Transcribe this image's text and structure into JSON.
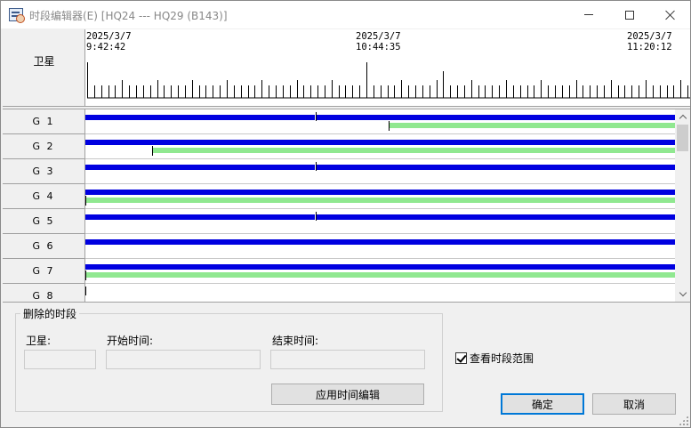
{
  "window": {
    "title": "时段编辑器(E) [HQ24 --- HQ29 (B143)]"
  },
  "timeline": {
    "header_label": "卫星",
    "start": {
      "date": "2025/3/7",
      "time": "9:42:42"
    },
    "middle": {
      "date": "2025/3/7",
      "time": "10:44:35"
    },
    "end": {
      "date": "2025/3/7",
      "time": "11:20:12"
    }
  },
  "rows": [
    {
      "label": "G 1",
      "blue": [
        [
          0,
          0.389
        ],
        [
          0.392,
          1
        ]
      ],
      "green": [
        [
          0.515,
          1
        ]
      ],
      "marks": [
        0.39,
        0.514
      ]
    },
    {
      "label": "G 2",
      "blue": [
        [
          0,
          1
        ]
      ],
      "green": [
        [
          0.114,
          1
        ]
      ],
      "marks": [
        0.113
      ]
    },
    {
      "label": "G 3",
      "blue": [
        [
          0,
          0.389
        ],
        [
          0.392,
          1
        ]
      ],
      "green": [],
      "marks": [
        0.39
      ]
    },
    {
      "label": "G 4",
      "blue": [
        [
          0,
          1
        ]
      ],
      "green": [
        [
          0,
          1
        ]
      ],
      "marks": [
        0
      ]
    },
    {
      "label": "G 5",
      "blue": [
        [
          0,
          0.389
        ],
        [
          0.392,
          1
        ]
      ],
      "green": [],
      "marks": [
        0.39
      ]
    },
    {
      "label": "G 6",
      "blue": [
        [
          0,
          1
        ]
      ],
      "green": [],
      "marks": []
    },
    {
      "label": "G 7",
      "blue": [
        [
          0,
          1
        ]
      ],
      "green": [
        [
          0,
          1
        ]
      ],
      "marks": [
        0
      ]
    },
    {
      "label": "G 8",
      "blue": [],
      "green": [],
      "marks": [
        0
      ]
    }
  ],
  "deleted_group": {
    "title": "删除的时段",
    "satellite_label": "卫星:",
    "start_label": "开始时间:",
    "end_label": "结束时间:",
    "satellite_value": "",
    "start_value": "",
    "end_value": "",
    "apply_button": "应用时间编辑"
  },
  "view_range": {
    "label": "查看时段范围",
    "checked": true
  },
  "buttons": {
    "ok": "确定",
    "cancel": "取消"
  },
  "colors": {
    "blue_bar": "#0000e0",
    "green_bar": "#90e890"
  }
}
